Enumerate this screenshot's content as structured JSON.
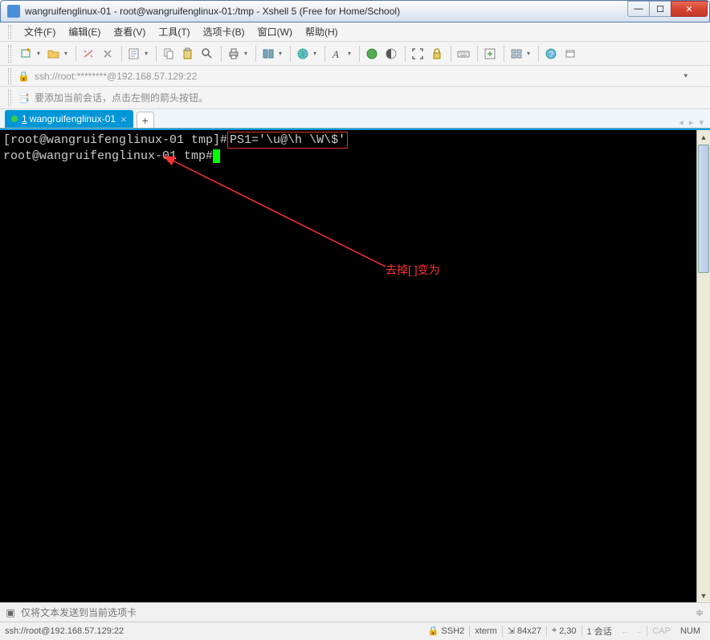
{
  "titlebar": {
    "text": "wangruifenglinux-01 - root@wangruifenglinux-01:/tmp - Xshell 5 (Free for Home/School)"
  },
  "menubar": {
    "items": [
      "文件(F)",
      "编辑(E)",
      "查看(V)",
      "工具(T)",
      "选项卡(B)",
      "窗口(W)",
      "帮助(H)"
    ]
  },
  "addrbar": {
    "text": "ssh://root:********@192.168.57.129:22"
  },
  "hintbar": {
    "text": "要添加当前会话，点击左侧的箭头按钮。"
  },
  "tabs": {
    "active": {
      "num": "1",
      "label": "wangruifenglinux-01"
    }
  },
  "terminal": {
    "line1_prompt": "[root@wangruifenglinux-01 tmp]#",
    "line1_cmd": "PS1='\\u@\\h \\W\\$'",
    "line2": "root@wangruifenglinux-01 tmp#"
  },
  "annotation": {
    "text": "去掉[ ]变为"
  },
  "inputbar": {
    "placeholder": "仅将文本发送到当前选项卡"
  },
  "statusbar": {
    "conn": "ssh://root@192.168.57.129:22",
    "ssh": "SSH2",
    "term": "xterm",
    "size": "84x27",
    "pos": "2,30",
    "sessions": "1 会话",
    "cap": "CAP",
    "num": "NUM"
  }
}
